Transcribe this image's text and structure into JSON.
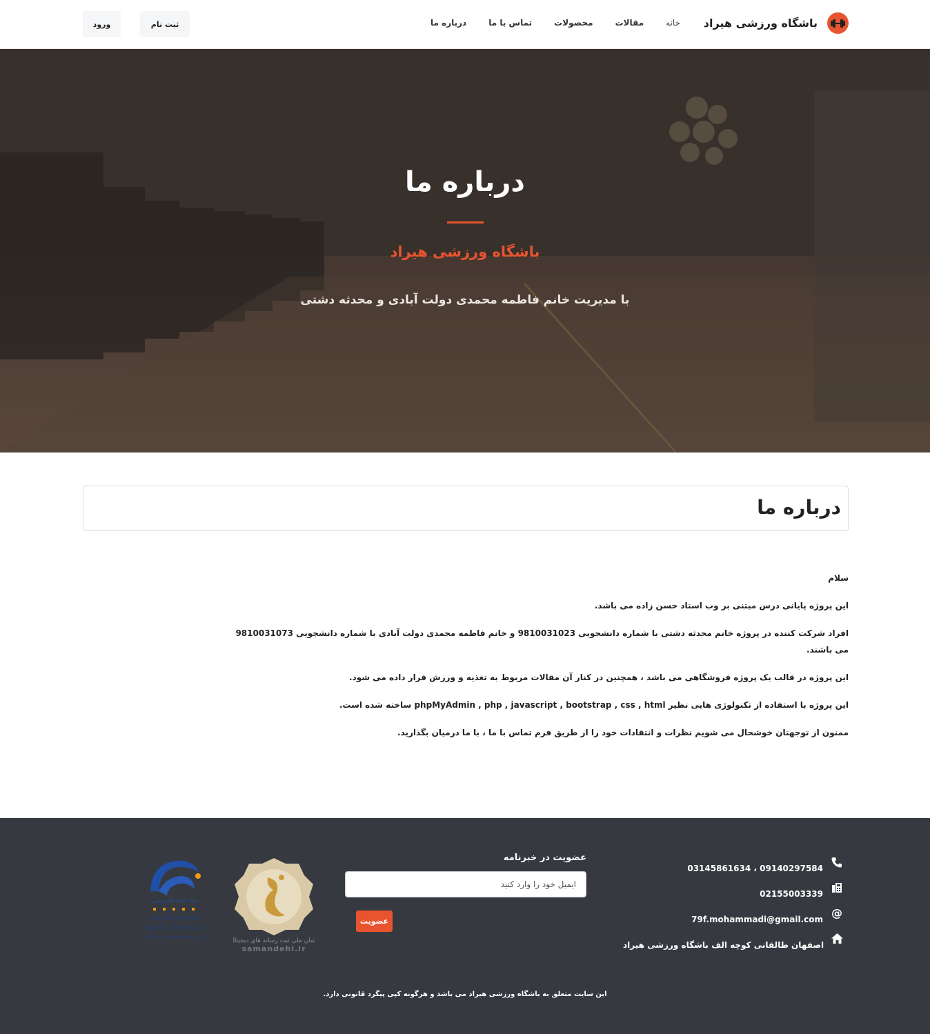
{
  "brand": {
    "name": "باشگاه ورزشی هیراد"
  },
  "nav": {
    "items": [
      {
        "label": "خانه"
      },
      {
        "label": "مقالات"
      },
      {
        "label": "محصولات"
      },
      {
        "label": "تماس با ما"
      },
      {
        "label": "درباره ما"
      }
    ]
  },
  "auth": {
    "login_label": "ورود",
    "signup_label": "ثبت نام"
  },
  "hero": {
    "title": "درباره ما",
    "subtitle": "باشگاه ورزشی هیراد",
    "description": "با مدیریت خانم فاطمه محمدی دولت آبادی و محدثه دشتی"
  },
  "content": {
    "heading": "درباره ما",
    "paragraphs": [
      "سلام",
      "این پروژه پایانی درس مبتنی بر وب استاد حسن زاده می باشد.",
      "افراد شرکت کننده در پروژه خانم محدثه دشتی با شماره دانشجویی 9810031023 و خانم فاطمه محمدی دولت آبادی با شماره دانشجویی 9810031073 می باشند.",
      "این پروژه در قالب یک پروژه فروشگاهی می باشد ، همچنین در کنار آن مقالات مربوط به تغذیه و ورزش قرار داده می شود.",
      "این پروژه با استفاده از تکنولوژی هایی نظیر phpMyAdmin , php , javascript , bootstrap , css , html ساخته شده است.",
      "ممنون از توجهتان خوشحال می شویم نظرات و انتقادات خود را از طریق فرم تماس با ما ، با ما درمیان بگذارید."
    ]
  },
  "footer": {
    "contacts": [
      {
        "icon": "phone-icon",
        "text": "09140297584 ، 03145861634"
      },
      {
        "icon": "fax-icon",
        "text": "02155003339"
      },
      {
        "icon": "at-icon",
        "text": "79f.mohammadi@gmail.com"
      },
      {
        "icon": "home-icon",
        "text": "اصفهان طالقانی کوچه الف باشگاه ورزشی هیراد"
      }
    ],
    "newsletter": {
      "title": "عضویت در خبرنامه",
      "placeholder": "ایمیل خود را وارد کنید",
      "button_label": "عضویت"
    },
    "badges": {
      "saman": "samandehi.ir",
      "enamad": "enamad"
    },
    "copyright": "این سایت متعلق به باشگاه ورزشی هیراد می باشد و هرگونه کپی پیگرد قانونی دارد."
  },
  "colors": {
    "accent": "#e8542f",
    "footer_bg": "#363a40"
  }
}
